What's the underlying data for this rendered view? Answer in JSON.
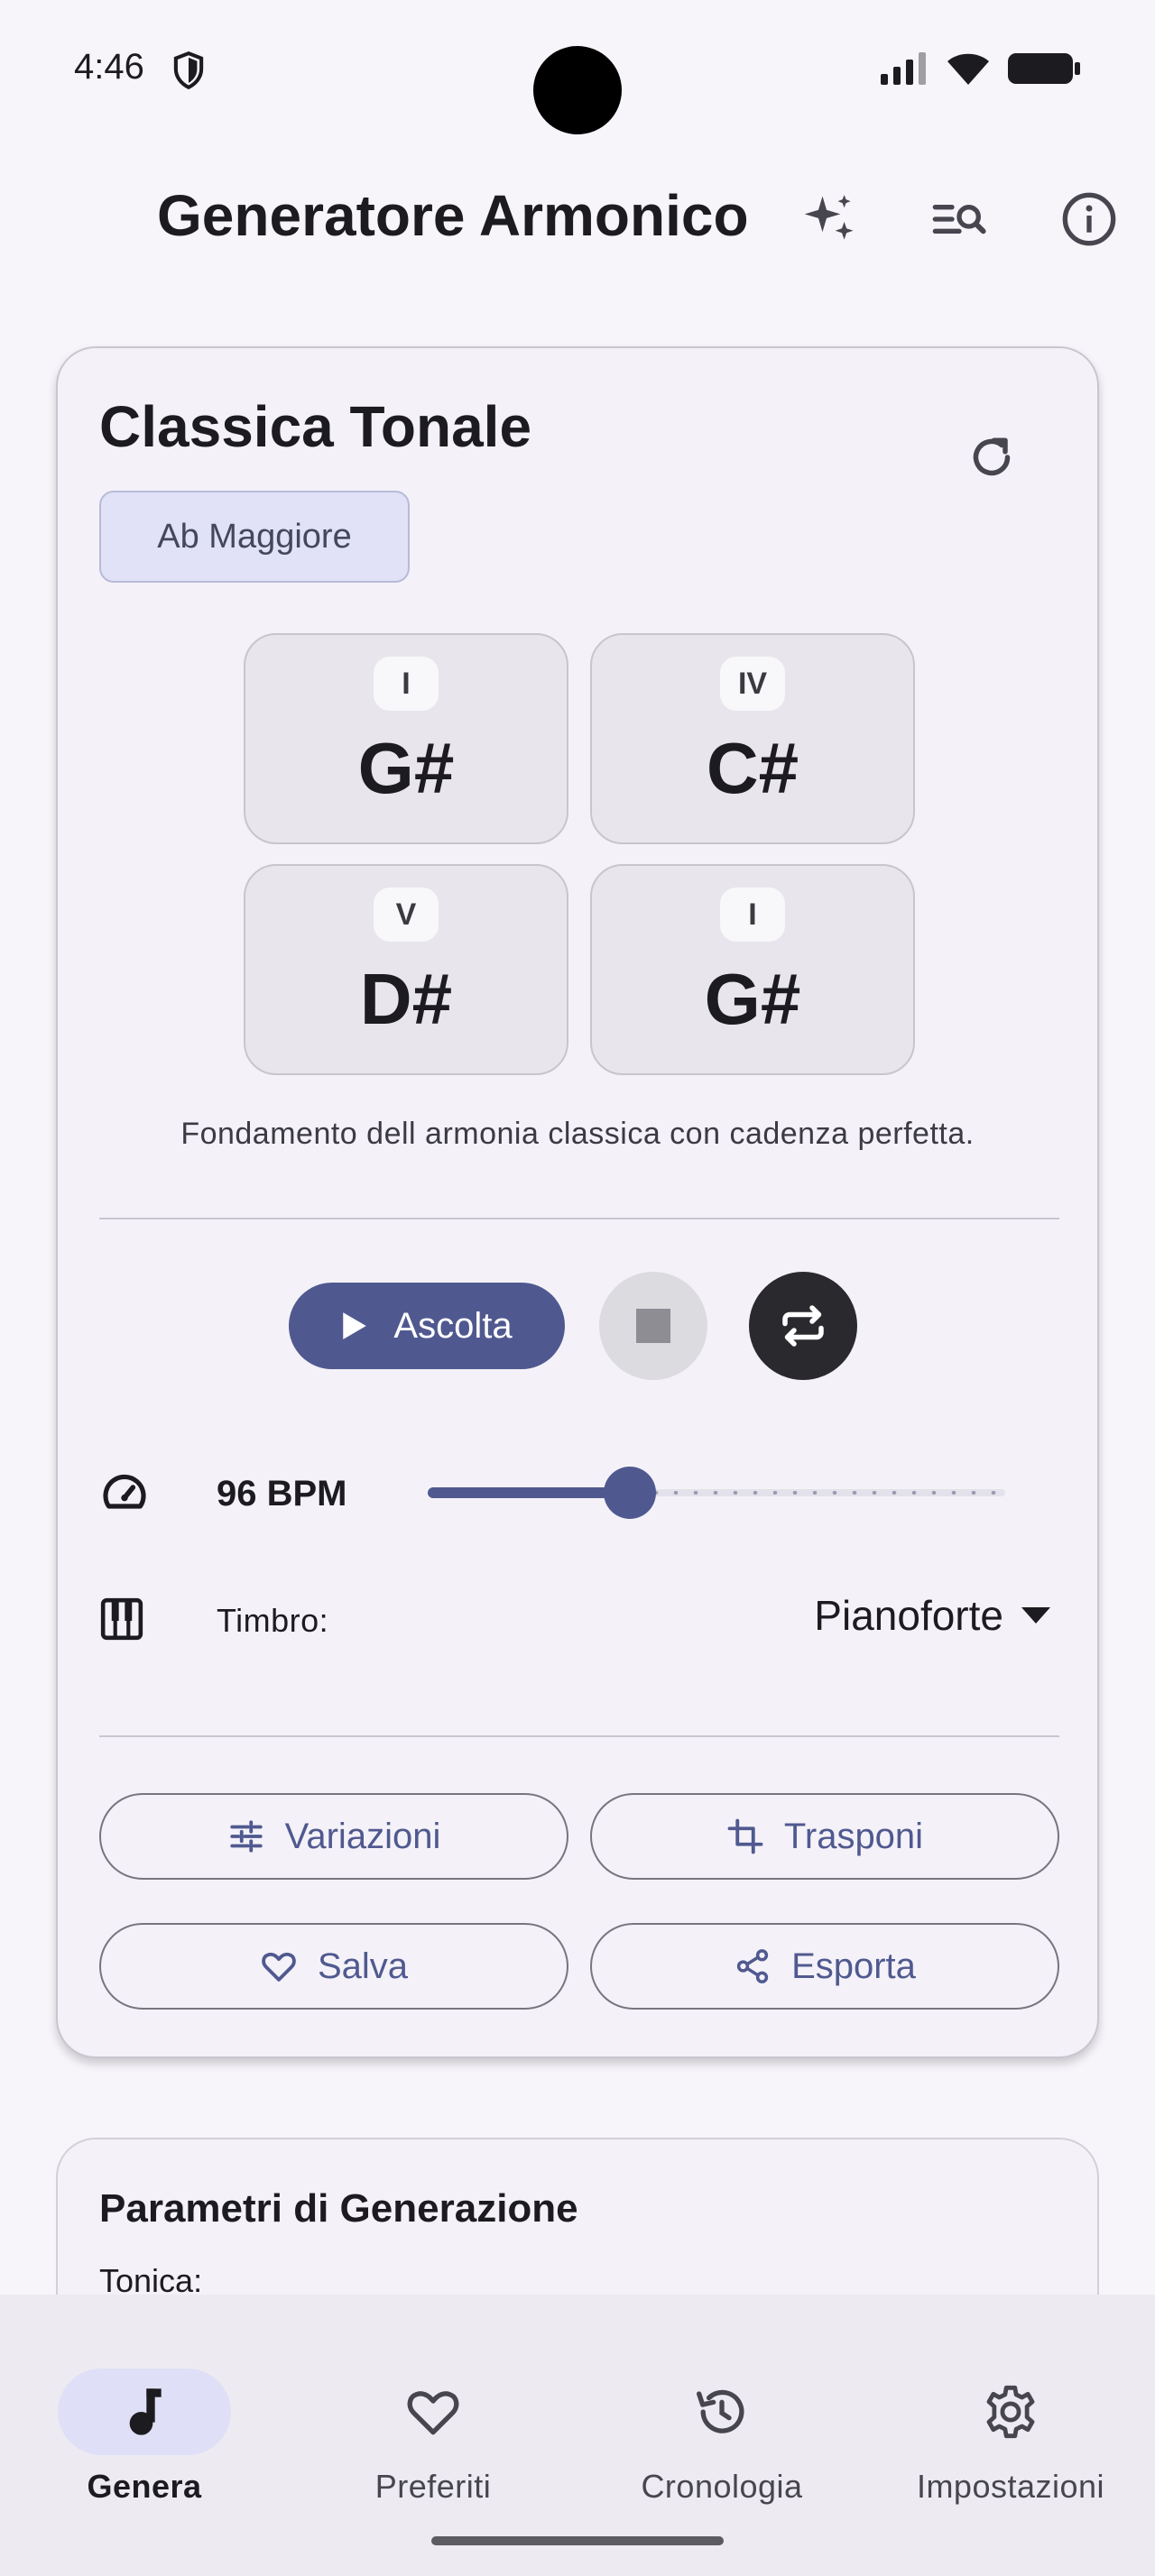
{
  "status_bar": {
    "time": "4:46"
  },
  "app_bar": {
    "title": "Generatore Armonico",
    "icons": [
      "sparkle-icon",
      "search-list-icon",
      "info-icon"
    ]
  },
  "progression_card": {
    "title": "Classica Tonale",
    "key_chip": "Ab Maggiore",
    "chords": [
      {
        "degree": "I",
        "name": "G#"
      },
      {
        "degree": "IV",
        "name": "C#"
      },
      {
        "degree": "V",
        "name": "D#"
      },
      {
        "degree": "I",
        "name": "G#"
      }
    ],
    "description": "Fondamento dell armonia classica con cadenza perfetta.",
    "play_label": "Ascolta",
    "tempo": {
      "label": "96 BPM",
      "slider_value": 0.35
    },
    "timbre": {
      "label": "Timbro:",
      "value": "Pianoforte"
    },
    "actions": {
      "variations": "Variazioni",
      "transpose": "Trasponi",
      "save": "Salva",
      "export": "Esporta"
    }
  },
  "params_card": {
    "title": "Parametri di Generazione",
    "first_field_label": "Tonica:"
  },
  "bottom_nav": {
    "items": [
      {
        "label": "Genera",
        "icon": "music-note-icon",
        "active": true
      },
      {
        "label": "Preferiti",
        "icon": "heart-icon",
        "active": false
      },
      {
        "label": "Cronologia",
        "icon": "history-icon",
        "active": false
      },
      {
        "label": "Impostazioni",
        "icon": "gear-icon",
        "active": false
      }
    ]
  },
  "colors": {
    "primary": "#50598f",
    "chip_bg": "#e1e2f7",
    "background": "#f7f5fa"
  }
}
